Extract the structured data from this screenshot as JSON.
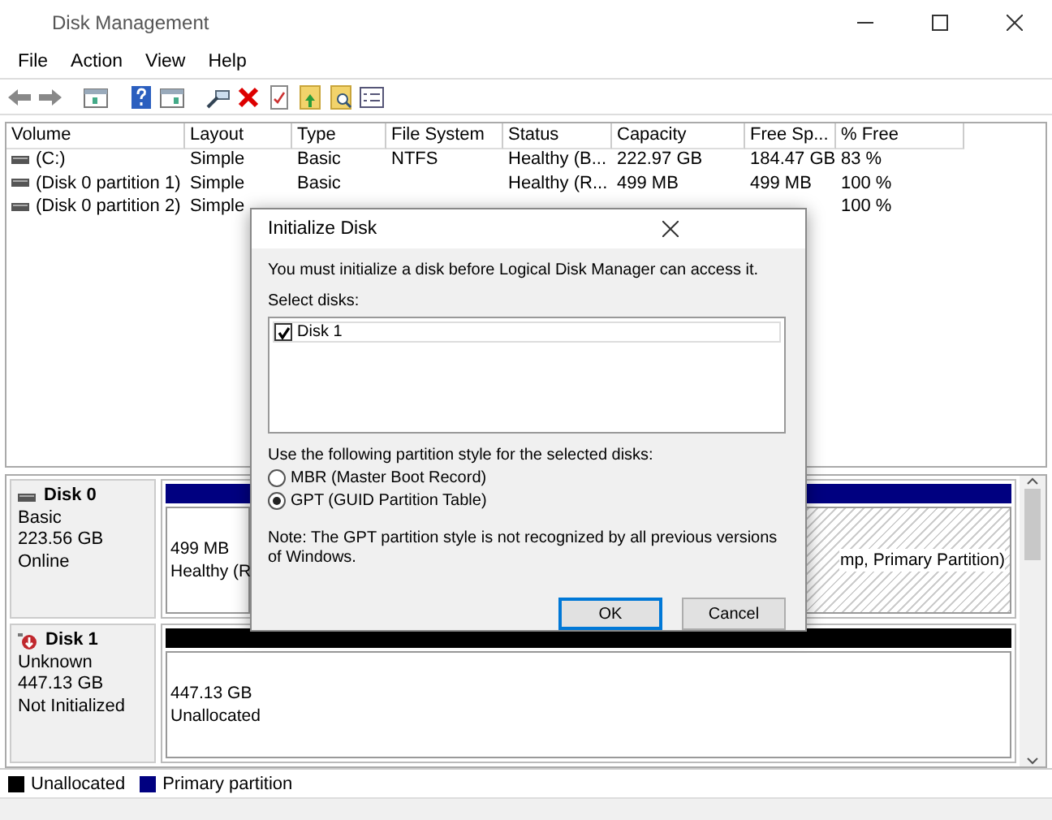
{
  "window": {
    "title": "Disk Management"
  },
  "menu": [
    "File",
    "Action",
    "View",
    "Help"
  ],
  "volume_table": {
    "columns": [
      "Volume",
      "Layout",
      "Type",
      "File System",
      "Status",
      "Capacity",
      "Free Sp...",
      "% Free"
    ],
    "rows": [
      {
        "cells": [
          "(C:)",
          "Simple",
          "Basic",
          "NTFS",
          "Healthy (B...",
          "222.97 GB",
          "184.47 GB",
          "83 %"
        ]
      },
      {
        "cells": [
          "(Disk 0 partition 1)",
          "Simple",
          "Basic",
          "",
          "Healthy (R...",
          "499 MB",
          "499 MB",
          "100 %"
        ]
      },
      {
        "cells": [
          "(Disk 0 partition 2)",
          "Simple",
          null,
          null,
          null,
          null,
          null,
          "100 %"
        ]
      }
    ]
  },
  "disks": [
    {
      "name": "Disk 0",
      "kind": "online",
      "lines": [
        "Basic",
        "223.56 GB",
        "Online"
      ],
      "partitions": [
        {
          "kind": "primary",
          "selected": false,
          "lines": [
            "499 MB",
            "Healthy (R"
          ]
        },
        {
          "kind": "primary",
          "selected": true,
          "lines": [
            "mp, Primary Partition)"
          ]
        }
      ]
    },
    {
      "name": "Disk 1",
      "kind": "not_initialized",
      "lines": [
        "Unknown",
        "447.13 GB",
        "Not Initialized"
      ],
      "partitions": [
        {
          "kind": "unallocated",
          "selected": false,
          "lines": [
            "447.13 GB",
            "Unallocated"
          ]
        }
      ]
    }
  ],
  "legend": [
    {
      "label": "Unallocated",
      "color": "#000000"
    },
    {
      "label": "Primary partition",
      "color": "#000080"
    }
  ],
  "dialog": {
    "title": "Initialize Disk",
    "message": "You must initialize a disk before Logical Disk Manager can access it.",
    "select_label": "Select disks:",
    "disks": [
      {
        "label": "Disk 1",
        "checked": true
      }
    ],
    "style_label": "Use the following partition style for the selected disks:",
    "styles": [
      {
        "label": "MBR (Master Boot Record)",
        "selected": false
      },
      {
        "label": "GPT (GUID Partition Table)",
        "selected": true
      }
    ],
    "note": "Note: The GPT partition style is not recognized by all previous versions of Windows.",
    "buttons": [
      {
        "label": "OK",
        "default": true
      },
      {
        "label": "Cancel",
        "default": false
      }
    ]
  }
}
